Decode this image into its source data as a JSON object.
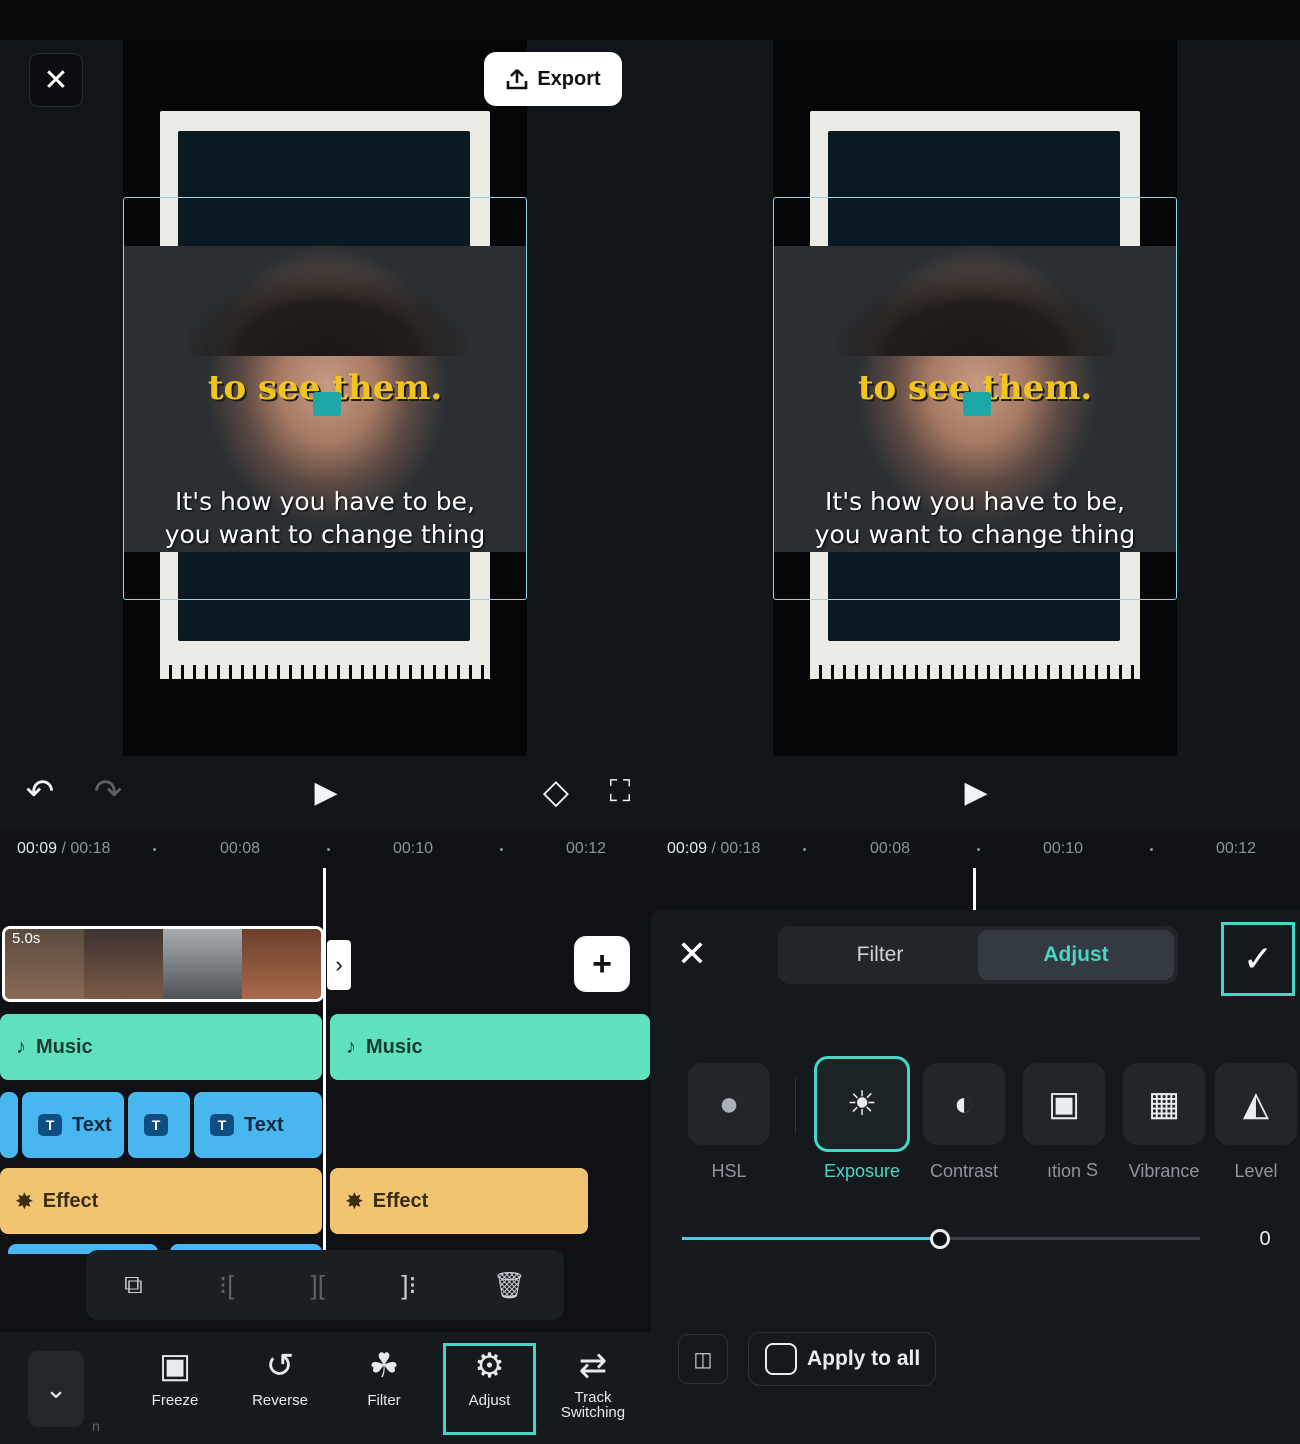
{
  "header": {
    "close_glyph": "✕",
    "export_label": "Export",
    "export_icon": "upload-icon"
  },
  "preview": {
    "caption_top": "to see them.",
    "caption_line1": "It's how you have to be,",
    "caption_line2": "you want to change thing"
  },
  "controls": {
    "undo_glyph": "↶",
    "redo_glyph": "↷",
    "play_glyph": "▶",
    "keyframe_glyph": "◇",
    "fullscreen_glyph": "⛶"
  },
  "time": {
    "current": "00:09",
    "total": "/ 00:18",
    "ticks": [
      "00:08",
      "00:10",
      "00:12"
    ]
  },
  "timeline": {
    "clip_length": "5.0s",
    "expand_glyph": "›",
    "add_glyph": "+",
    "music_label": "Music",
    "text_label": "Text",
    "text_badge": "T",
    "effect_label": "Effect",
    "edit_tools": [
      "⧉",
      "⁝[",
      "][",
      "]⁝",
      "🗑"
    ]
  },
  "toolbar": {
    "collapse_glyph": "⌄",
    "items": [
      {
        "label": "Freeze",
        "icon": "▣"
      },
      {
        "label": "Reverse",
        "icon": "↺"
      },
      {
        "label": "Filter",
        "icon": "☘"
      },
      {
        "label": "Adjust",
        "icon": "⚙"
      },
      {
        "label": "Track\nSwitching",
        "icon": "⇄"
      }
    ],
    "partial_label": "n"
  },
  "adjust_panel": {
    "close_glyph": "✕",
    "confirm_glyph": "✓",
    "tabs": [
      "Filter",
      "Adjust"
    ],
    "active_tab": "Adjust",
    "options": [
      {
        "label": "HSL",
        "icon": "●"
      },
      {
        "label": "Exposure",
        "icon": "☀"
      },
      {
        "label": "Contrast",
        "icon": "◐"
      },
      {
        "label": "ıtion",
        "icon": "▣"
      },
      {
        "label": "S",
        "icon": ""
      },
      {
        "label": "Vibrance",
        "icon": "▦"
      },
      {
        "label": "Level",
        "icon": "◭"
      }
    ],
    "selected_option": "Exposure",
    "slider_value": "0",
    "slider_fraction": 0.5,
    "compare_glyph": "◫",
    "apply_all_label": "Apply to all"
  },
  "colors": {
    "accent": "#44d7c3",
    "music": "#5fe1be",
    "text_track": "#49b7ef",
    "effect": "#f0c470"
  }
}
